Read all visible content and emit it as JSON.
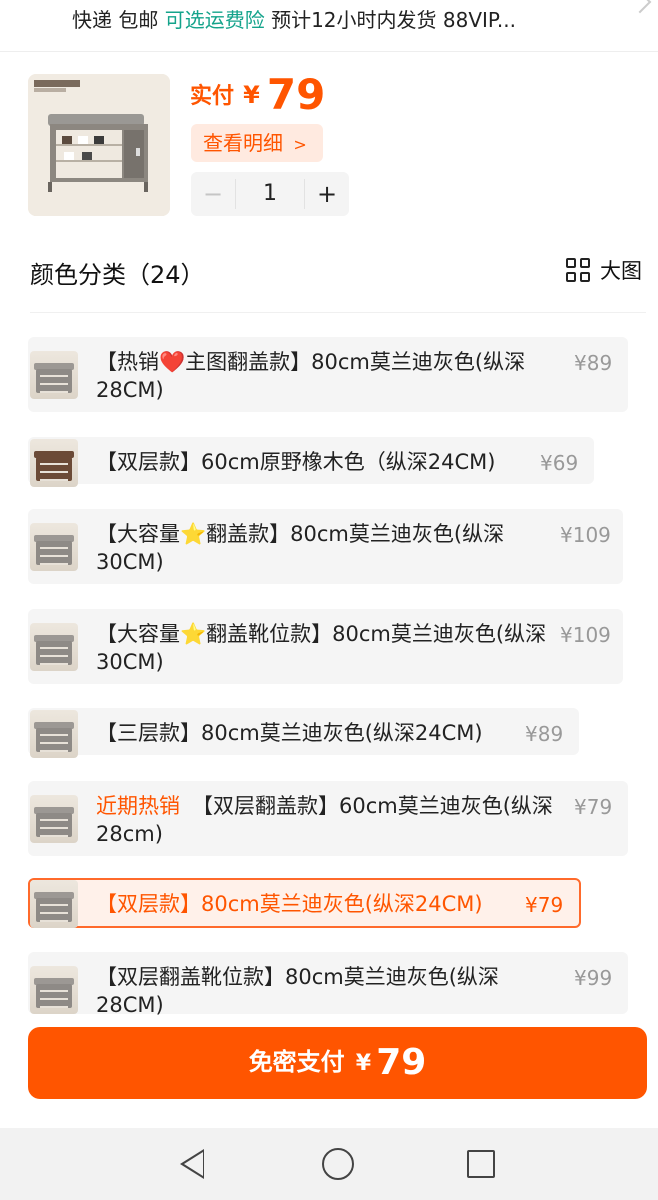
{
  "shipping": {
    "express": "快递",
    "free": "包邮",
    "insurance": "可选运费险",
    "eta": "预计12小时内发货",
    "vip": "88VIP..."
  },
  "product": {
    "price_label": "实付",
    "currency": "¥",
    "price": "79",
    "detail_label": "查看明细",
    "detail_arrow": ">",
    "quantity": "1",
    "minus": "−",
    "plus": "+"
  },
  "section": {
    "title": "颜色分类（24）",
    "big_view": "大图"
  },
  "options": [
    {
      "hot": "",
      "text": "【热销❤️主图翻盖款】80cm莫兰迪灰色(纵深28CM)",
      "price": "¥89",
      "selected": false
    },
    {
      "hot": "",
      "text": "【双层款】60cm原野橡木色（纵深24CM)",
      "price": "¥69",
      "selected": false
    },
    {
      "hot": "",
      "text": "【大容量⭐翻盖款】80cm莫兰迪灰色(纵深30CM)",
      "price": "¥109",
      "selected": false
    },
    {
      "hot": "",
      "text": "【大容量⭐翻盖靴位款】80cm莫兰迪灰色(纵深30CM)",
      "price": "¥109",
      "selected": false
    },
    {
      "hot": "",
      "text": "【三层款】80cm莫兰迪灰色(纵深24CM)",
      "price": "¥89",
      "selected": false
    },
    {
      "hot": "近期热销",
      "text": "【双层翻盖款】60cm莫兰迪灰色(纵深28cm)",
      "price": "¥79",
      "selected": false
    },
    {
      "hot": "",
      "text": "【双层款】80cm莫兰迪灰色(纵深24CM)",
      "price": "¥79",
      "selected": true
    },
    {
      "hot": "",
      "text": "【双层翻盖靴位款】80cm莫兰迪灰色(纵深28CM)",
      "price": "¥99",
      "selected": false
    }
  ],
  "pay": {
    "label": "免密支付",
    "currency": "¥",
    "amount": "79"
  },
  "colors": {
    "accent": "#ff5500",
    "green": "#14a38b"
  }
}
